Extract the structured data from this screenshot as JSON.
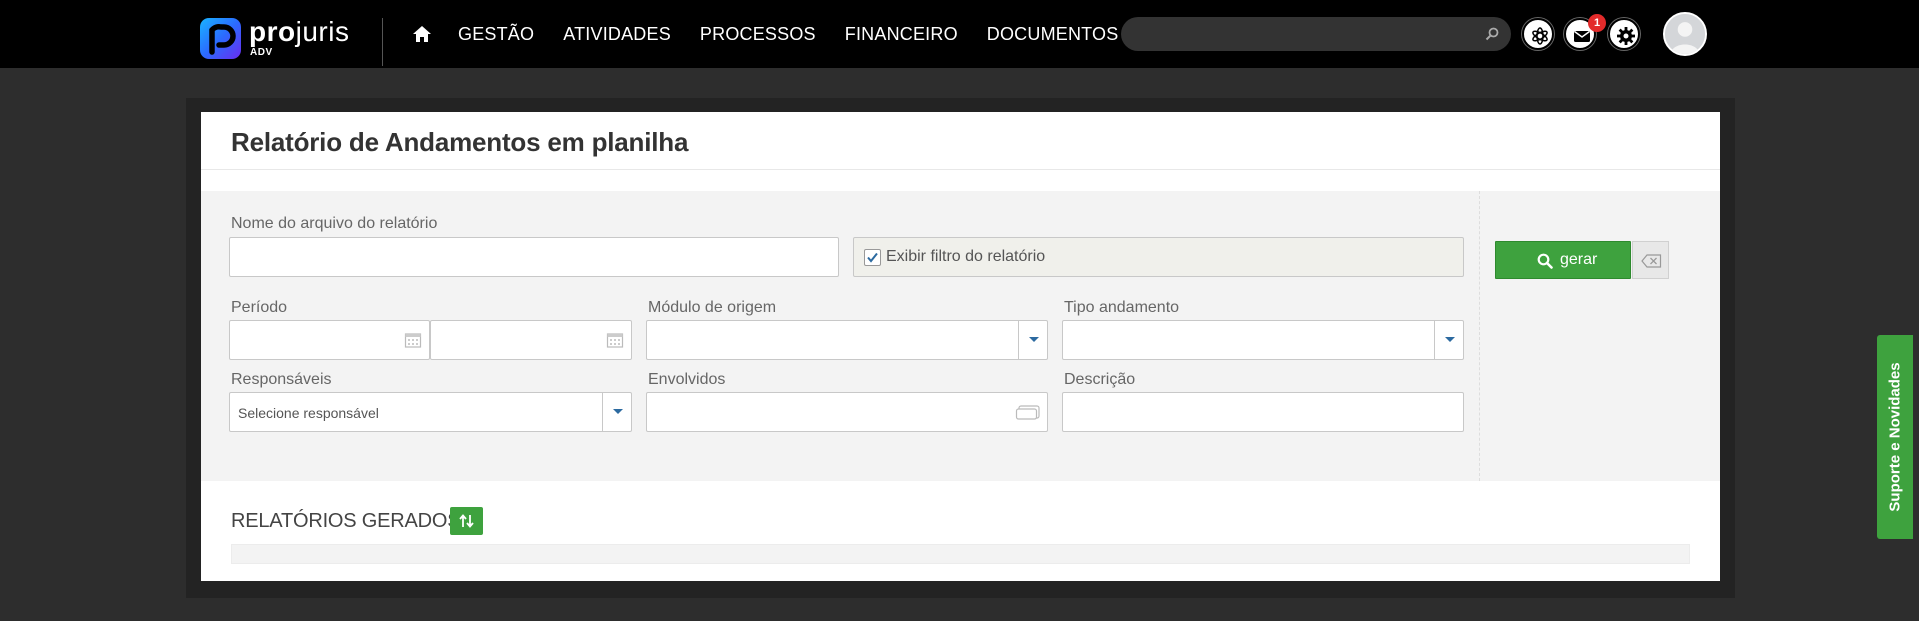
{
  "brand": {
    "name_bold": "pro",
    "name_regular": "juris",
    "sub": "ADV"
  },
  "nav": {
    "items": [
      "GESTÃO",
      "ATIVIDADES",
      "PROCESSOS",
      "FINANCEIRO",
      "DOCUMENTOS"
    ]
  },
  "header": {
    "search_placeholder": "",
    "notifications_count": "1"
  },
  "page": {
    "title": "Relatório de Andamentos em planilha"
  },
  "form": {
    "file_name_label": "Nome do arquivo do relatório",
    "file_name_value": "",
    "show_filter_label": "Exibir filtro do relatório",
    "show_filter_checked": true,
    "period_label": "Período",
    "period_start": "",
    "period_end": "",
    "origin_module_label": "Módulo de origem",
    "origin_module_value": "",
    "movement_type_label": "Tipo andamento",
    "movement_type_value": "",
    "responsibles_label": "Responsáveis",
    "responsibles_placeholder": "Selecione responsável",
    "involved_label": "Envolvidos",
    "involved_value": "",
    "description_label": "Descrição",
    "description_value": ""
  },
  "actions": {
    "generate_label": "gerar"
  },
  "reports": {
    "section_title": "RELATÓRIOS GERADOS"
  },
  "support_tab": {
    "label": "Suporte e Novidades"
  },
  "colors": {
    "accent_green": "#3ea23e",
    "topbar_bg": "#000000",
    "page_bg": "#2d2d2d",
    "badge_red": "#e32b2b"
  }
}
